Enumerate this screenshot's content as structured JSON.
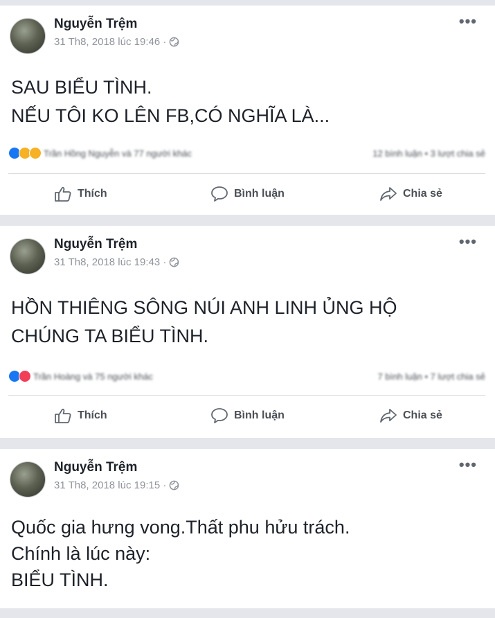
{
  "posts": [
    {
      "author": "Nguyễn Trệm",
      "timestamp": "31 Th8, 2018 lúc 19:46 ·",
      "text_lines": [
        "SAU BIỂU TÌNH.",
        "NẾU TÔI KO LÊN FB,CÓ NGHĨA LÀ..."
      ],
      "reactions_summary": "Trần Hồng Nguyễn và 77 người khác",
      "comments_shares": "12 bình luận • 3 lượt chia sẻ",
      "actions": {
        "like": "Thích",
        "comment": "Bình luận",
        "share": "Chia sẻ"
      }
    },
    {
      "author": "Nguyễn Trệm",
      "timestamp": "31 Th8, 2018 lúc 19:43 ·",
      "text_lines": [
        "HỒN THIÊNG SÔNG NÚI ANH LINH ỦNG HỘ",
        "CHÚNG TA BIỂU TÌNH."
      ],
      "reactions_summary": "Trần Hoàng và 75 người khác",
      "comments_shares": "7 bình luận • 7 lượt chia sẻ",
      "actions": {
        "like": "Thích",
        "comment": "Bình luận",
        "share": "Chia sẻ"
      }
    },
    {
      "author": "Nguyễn Trệm",
      "timestamp": "31 Th8, 2018 lúc 19:15 ·",
      "text_lines": [
        "Quốc gia hưng vong.Thất phu hửu trách.",
        "Chính là lúc này:",
        "BIỂU TÌNH."
      ]
    }
  ],
  "colors": {
    "background": "#e4e6eb",
    "card": "#ffffff",
    "like_blue": "#1877f2",
    "love_red": "#f33e58",
    "haha_yellow": "#f7b125",
    "text_muted": "#90949c"
  },
  "icons": {
    "more": "more-horizontal-icon",
    "privacy": "globe-icon",
    "like": "thumbs-up-icon",
    "comment": "comment-bubble-icon",
    "share": "share-arrow-icon"
  }
}
